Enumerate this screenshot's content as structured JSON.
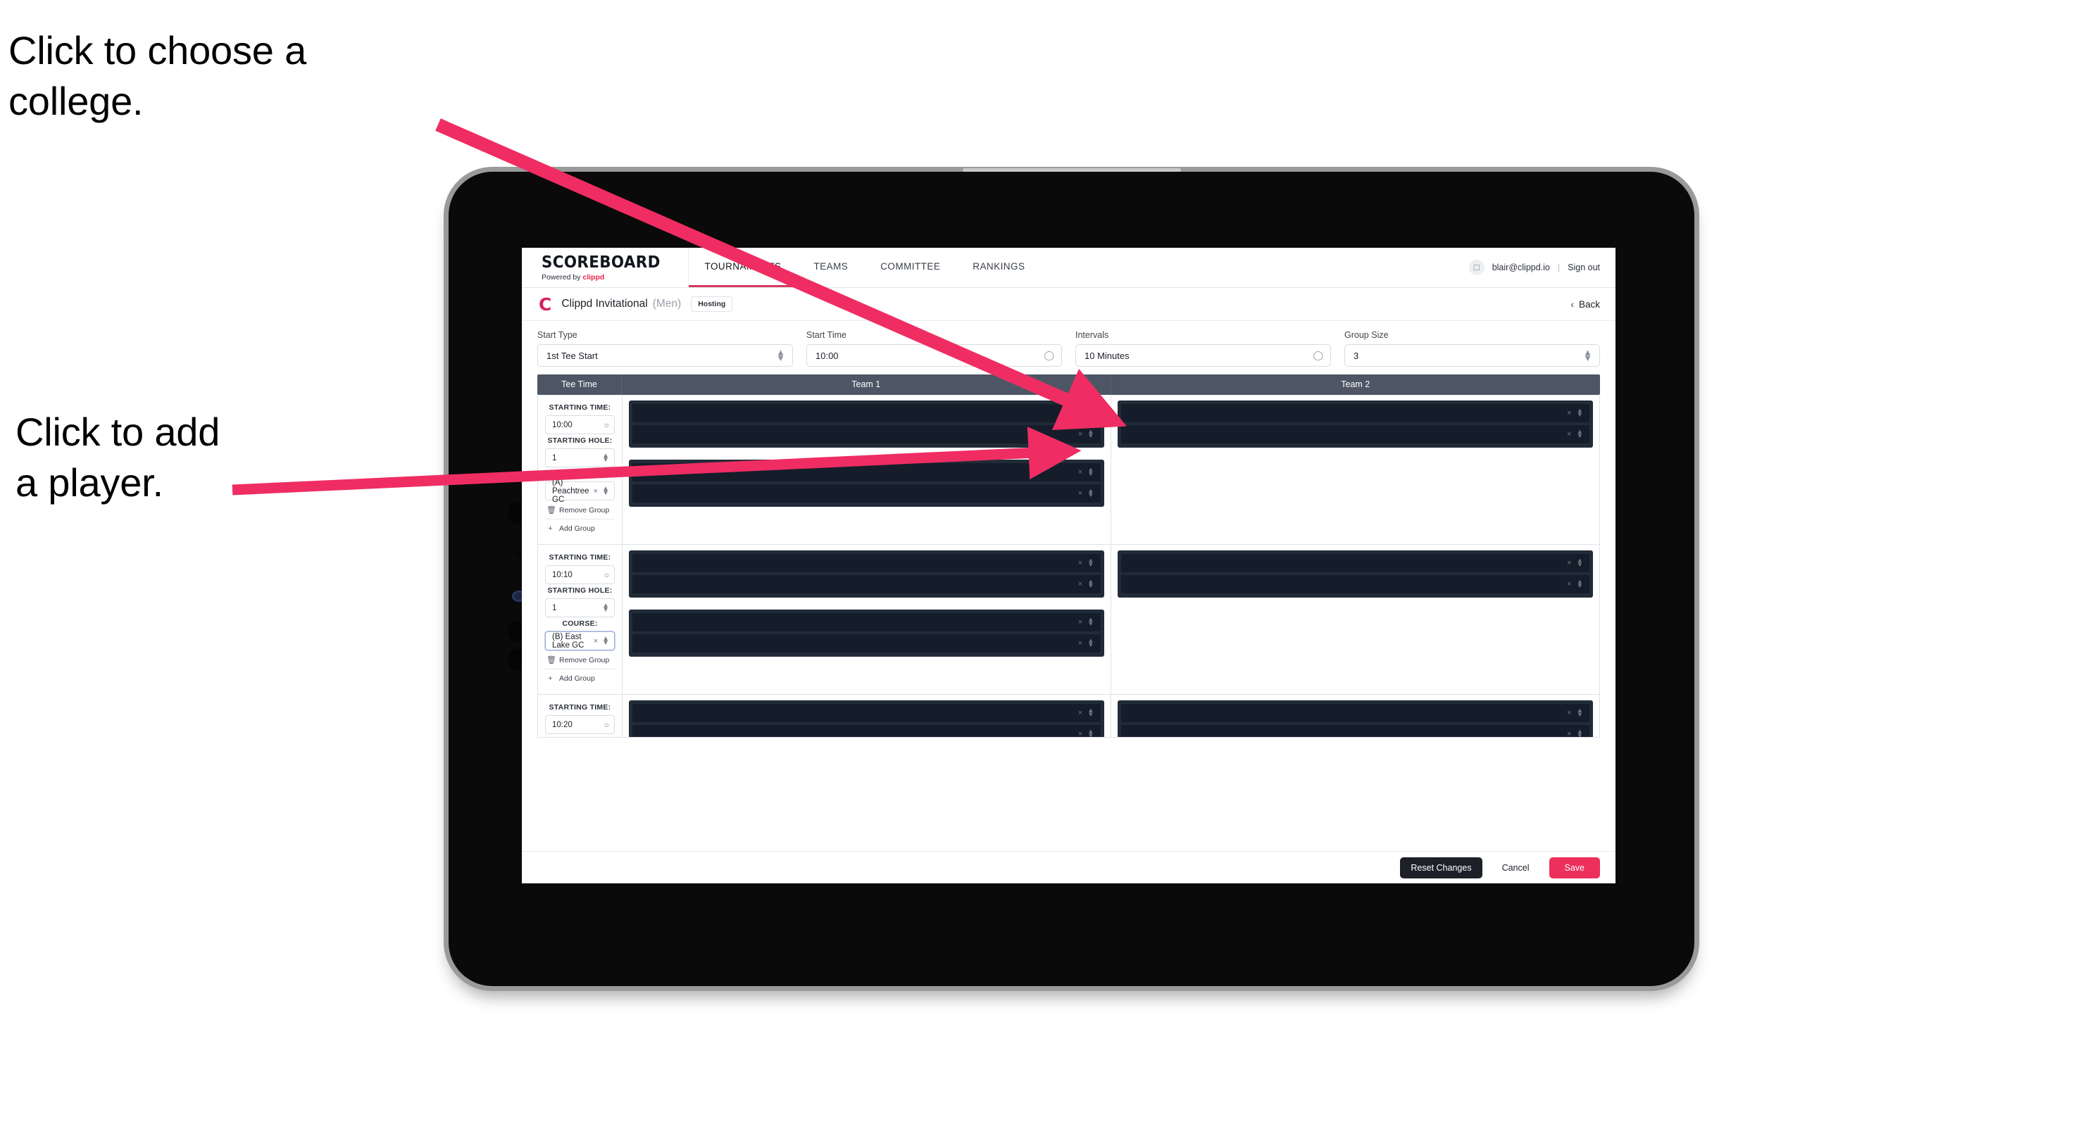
{
  "annotations": [
    {
      "id": "choose-college",
      "text": "Click to choose a\ncollege."
    },
    {
      "id": "add-player",
      "text": "Click to add\na player."
    }
  ],
  "accent": {
    "brand_pink": "#e8274b",
    "save_pink": "#ec2f5b",
    "arrow_pink": "#ef2d63",
    "header_slate": "#4e5665",
    "row_dark": "#161d2a",
    "group_dark": "#222b38"
  },
  "topnav": {
    "brand_title": "SCOREBOARD",
    "brand_sub_prefix": "Powered by ",
    "brand_sub_name": "clippd",
    "tabs": [
      {
        "label": "TOURNAMENTS",
        "active": true
      },
      {
        "label": "TEAMS",
        "active": false
      },
      {
        "label": "COMMITTEE",
        "active": false
      },
      {
        "label": "RANKINGS",
        "active": false
      }
    ],
    "avatar_icon": "user-avatar-icon",
    "account_email": "blair@clippd.io",
    "separator": "|",
    "sign_out_label": "Sign out"
  },
  "tournament_bar": {
    "logo_letter": "C",
    "name": "Clippd Invitational",
    "gender": "(Men)",
    "badge": "Hosting",
    "back_chevron": "‹",
    "back_label": "Back"
  },
  "settings": [
    {
      "label": "Start Type",
      "value": "1st Tee Start",
      "adorn": "stepper"
    },
    {
      "label": "Start Time",
      "value": "10:00",
      "adorn": "clock"
    },
    {
      "label": "Intervals",
      "value": "10 Minutes",
      "adorn": "clock"
    },
    {
      "label": "Group Size",
      "value": "3",
      "adorn": "stepper"
    }
  ],
  "grid": {
    "columns": [
      "Tee Time",
      "Team 1",
      "Team 2"
    ],
    "labels": {
      "starting_time": "STARTING TIME:",
      "starting_hole": "STARTING HOLE:",
      "course": "COURSE:",
      "remove_group": "Remove Group",
      "add_group": "Add Group",
      "trash_icon": "trash-icon",
      "plus_icon": "plus-icon",
      "clear_icon": "×",
      "clock_icon": "clock-icon"
    },
    "rows": [
      {
        "starting_time": "10:00",
        "starting_hole": "1",
        "course": "(A) Peachtree GC",
        "course_focused": false,
        "team1_groups": [
          {
            "players": [
              "",
              ""
            ]
          },
          {
            "players": [
              "",
              ""
            ]
          }
        ],
        "team2_groups": [
          {
            "players": [
              "",
              ""
            ]
          }
        ]
      },
      {
        "starting_time": "10:10",
        "starting_hole": "1",
        "course": "(B) East Lake GC",
        "course_focused": true,
        "team1_groups": [
          {
            "players": [
              "",
              ""
            ]
          },
          {
            "players": [
              "",
              ""
            ]
          }
        ],
        "team2_groups": [
          {
            "players": [
              "",
              ""
            ]
          }
        ]
      },
      {
        "starting_time": "10:20",
        "starting_hole": "",
        "course": "",
        "course_focused": false,
        "team1_groups": [
          {
            "players": [
              "",
              ""
            ]
          }
        ],
        "team2_groups": [
          {
            "players": [
              "",
              ""
            ]
          }
        ]
      }
    ]
  },
  "footer": {
    "reset_label": "Reset Changes",
    "cancel_label": "Cancel",
    "save_label": "Save"
  }
}
